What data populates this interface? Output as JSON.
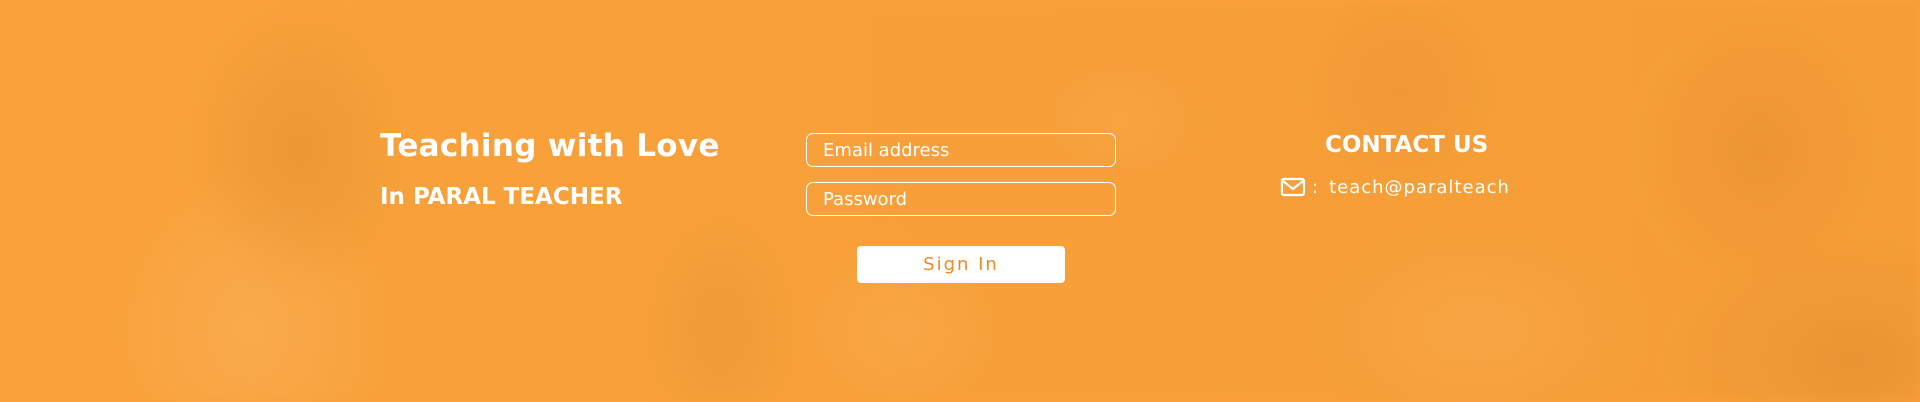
{
  "tagline": {
    "title": "Teaching with Love",
    "subtitle": "In PARAL TEACHER"
  },
  "login": {
    "email_placeholder": "Email address",
    "password_placeholder": "Password",
    "submit_label": "Sign In"
  },
  "contact": {
    "title": "CONTACT US",
    "separator": ":",
    "email": "teach@paralteach",
    "icon": "mail-icon"
  },
  "colors": {
    "background": "#f9a23c",
    "button_text": "#f08a1d",
    "text": "#ffffff"
  }
}
